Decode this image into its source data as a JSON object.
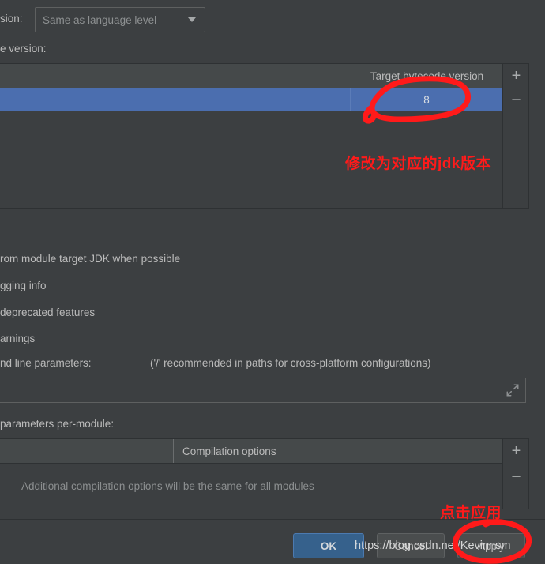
{
  "colors": {
    "window_bg": "#3c3f41",
    "table_header_bg": "#45494a",
    "selection_blue": "#4b6eaf",
    "ok_button_blue": "#36618c",
    "annotation_red": "#ff1a1a",
    "text": "#bbbbbb",
    "muted_text": "#8c8f90"
  },
  "bytecode_version_row": {
    "label": "sion:",
    "combo_value": "Same as language level",
    "dropdown_icon": "chevron-down-icon"
  },
  "per_module_bytecode": {
    "label": "e version:",
    "table": {
      "columns": [
        "",
        "Target bytecode version"
      ],
      "rows": [
        {
          "module": "",
          "target_bytecode_version": "8",
          "selected": true
        }
      ],
      "add_button": "+",
      "remove_button": "−"
    }
  },
  "options": [
    {
      "label": "rom module target JDK when possible"
    },
    {
      "label": "gging info"
    },
    {
      "label": "deprecated features"
    },
    {
      "label": "arnings"
    },
    {
      "label": "nd line parameters:"
    }
  ],
  "command_line": {
    "hint": "('/' recommended in paths for cross-platform configurations)",
    "field_value": "",
    "expand_icon": "expand-diagonal-icon"
  },
  "per_module_parameters": {
    "label": " parameters per-module:",
    "table": {
      "columns": [
        "",
        "Compilation options"
      ],
      "empty_message": "Additional compilation options will be the same for all modules",
      "add_button": "+",
      "remove_button": "−"
    }
  },
  "dialog_buttons": {
    "ok": "OK",
    "cancel": "Cancel",
    "apply": "Apply"
  },
  "annotations": {
    "jdk_note": "修改为对应的jdk版本",
    "apply_note": "点击应用"
  },
  "watermark": "https://blog.csdn.net/Kevinnsm"
}
